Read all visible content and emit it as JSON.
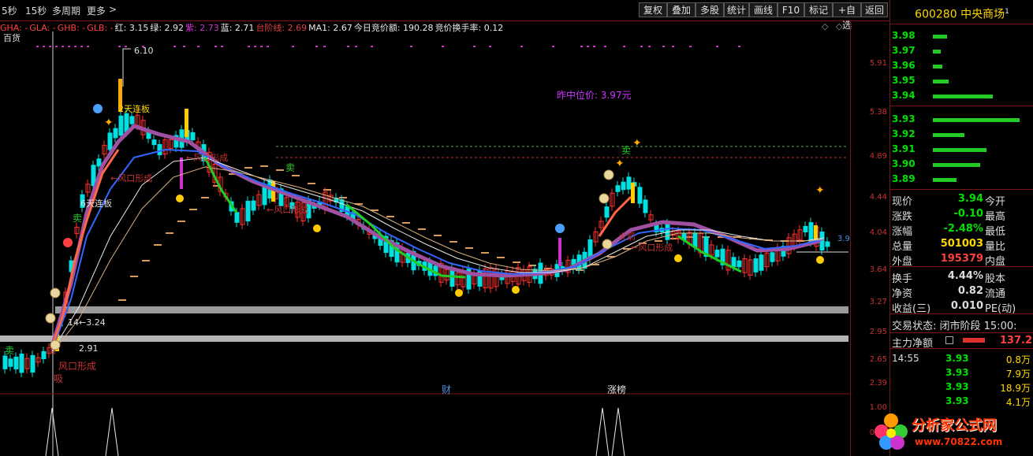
{
  "toolbar": {
    "periods": [
      "5秒",
      "15秒",
      "多周期",
      "更多"
    ],
    "buttons": [
      "复权",
      "叠加",
      "多股",
      "统计",
      "画线",
      "F10",
      "标记",
      "+自选",
      "返回"
    ]
  },
  "legend": [
    {
      "text": "GHA: -",
      "color": "#ff4040"
    },
    {
      "text": "GLA: -",
      "color": "#ff4040"
    },
    {
      "text": "GHB: -",
      "color": "#ff4040"
    },
    {
      "text": "GLB: -",
      "color": "#ff4040"
    },
    {
      "text": "红: 3.15",
      "color": "#e8e8e8"
    },
    {
      "text": "绿: 2.92",
      "color": "#e8e8e8"
    },
    {
      "text": "紫: 2.73",
      "color": "#cc33cc"
    },
    {
      "text": "蓝: 2.71",
      "color": "#e8e8e8"
    },
    {
      "text": "台阶线: 2.69",
      "color": "#e04040"
    },
    {
      "text": "MA1: 2.67",
      "color": "#e8e8e8"
    },
    {
      "text": "今日竞价额: 190.28",
      "color": "#e8e8e8"
    },
    {
      "text": "竞价换手率: 0.12",
      "color": "#e8e8e8"
    }
  ],
  "stock_tag": "百货",
  "yaxis_labels": [
    "5.91",
    "5.38",
    "4.89",
    "4.44",
    "4.04",
    "3.64",
    "3.27",
    "2.95",
    "2.65",
    "2.39",
    "1.00",
    "0.50"
  ],
  "annotations": {
    "high": "6.10",
    "prev_mid": "昨中位价: 3.97元",
    "limit_up_2": "2天连板",
    "limit_up_6": "6天连板",
    "wind_1": "←风口形成",
    "wind_2": "←风口形成",
    "wind_3": "←风口形成",
    "wind_4": "火箭",
    "wind_5": "←风口形成",
    "wind_bottom": "风口形成",
    "low_label_1": "14←3.24",
    "low_label_2": "2.91",
    "sell_1": "卖",
    "sell_2": "卖",
    "sell_3": "卖",
    "sell_4": "卖",
    "absorb": "吸",
    "marker_cai": "财",
    "marker_zhangbang": "涨榜",
    "right_val": "3.9"
  },
  "quote": {
    "code": "600280",
    "name": "中央商场",
    "sup": "1",
    "orderbook": [
      {
        "price": "3.98",
        "bar": 18
      },
      {
        "price": "3.97",
        "bar": 10
      },
      {
        "price": "3.96",
        "bar": 12
      },
      {
        "price": "3.95",
        "bar": 20
      },
      {
        "price": "3.94",
        "bar": 76
      },
      {
        "price": "3.93",
        "bar": 110
      },
      {
        "price": "3.92",
        "bar": 40
      },
      {
        "price": "3.91",
        "bar": 68
      },
      {
        "price": "3.90",
        "bar": 60
      },
      {
        "price": "3.89",
        "bar": 30
      }
    ],
    "info": [
      {
        "l1": "现价",
        "v": "3.94",
        "vc": "#00e000",
        "l2": "今开"
      },
      {
        "l1": "涨跌",
        "v": "-0.10",
        "vc": "#00e000",
        "l2": "最高"
      },
      {
        "l1": "涨幅",
        "v": "-2.48%",
        "vc": "#00e000",
        "l2": "最低"
      },
      {
        "l1": "总量",
        "v": "501003",
        "vc": "#ffd800",
        "l2": "量比"
      },
      {
        "l1": "外盘",
        "v": "195379",
        "vc": "#ff4040",
        "l2": "内盘"
      },
      {
        "l1": "换手",
        "v": "4.44%",
        "vc": "#dcdcdc",
        "l2": "股本"
      },
      {
        "l1": "净资",
        "v": "0.82",
        "vc": "#dcdcdc",
        "l2": "流通"
      },
      {
        "l1": "收益(三)",
        "v": "0.010",
        "vc": "#dcdcdc",
        "l2": "PE(动)"
      }
    ],
    "trade_status": "交易状态: 闭市阶段 15:00:",
    "main_flow_label": "主力净额",
    "main_flow_value": "137.2",
    "ticks": [
      {
        "time": "14:55",
        "price": "3.93",
        "vol": "0.8万"
      },
      {
        "time": "",
        "price": "3.93",
        "vol": "7.9万"
      },
      {
        "time": "",
        "price": "3.93",
        "vol": "18.9万"
      },
      {
        "time": "",
        "price": "3.93",
        "vol": "4.1万"
      }
    ]
  },
  "watermark": {
    "line1": "分析家公式网",
    "line2": "www.70822.com"
  }
}
